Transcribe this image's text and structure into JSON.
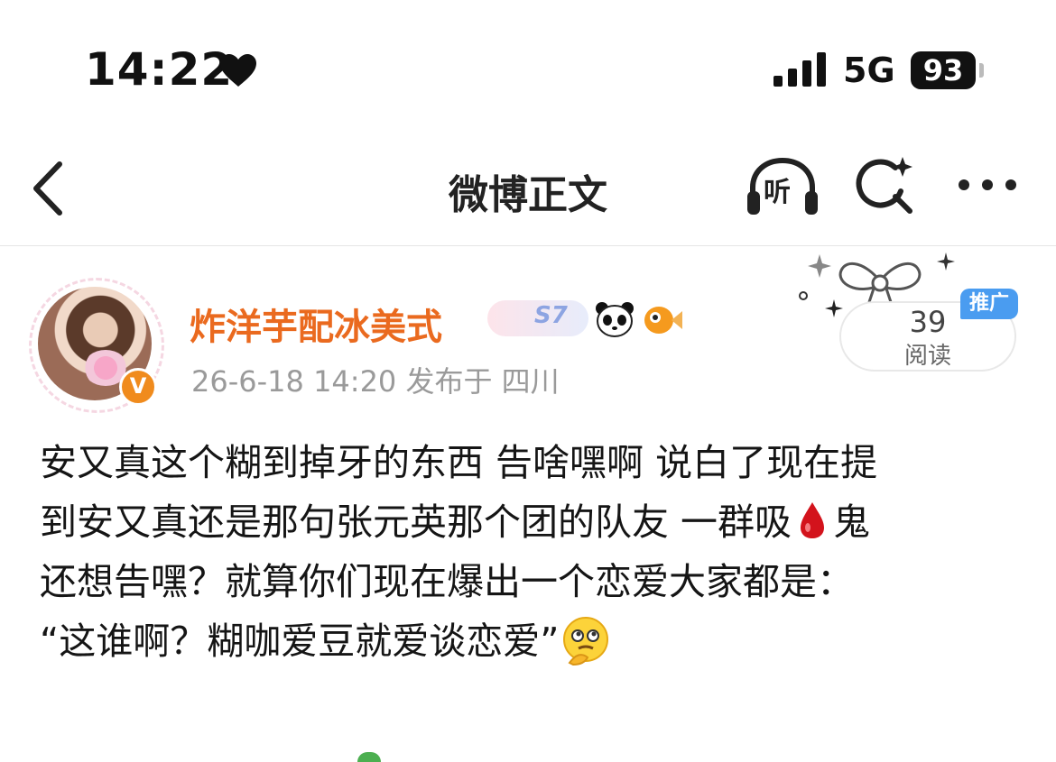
{
  "status_bar": {
    "time": "14:22",
    "network": "5G",
    "battery": "93"
  },
  "nav": {
    "title": "微博正文",
    "listen_label": "听"
  },
  "post": {
    "username": "炸洋芋配冰美式",
    "badge_text": "S7",
    "verified_mark": "V",
    "meta": "26-6-18 14:20  发布于 四川",
    "read_count": "39",
    "read_label": "阅读",
    "promo_tag": "推广",
    "lines": [
      "安又真这个糊到掉牙的东西 告啥嘿啊 说白了现在提",
      "到安又真还是那句张元英那个团的队友 一群吸",
      "鬼",
      "还想告嘿？就算你们现在爆出一个恋爱大家都是：",
      "“这谁啊？糊咖爱豆就爱谈恋爱”"
    ]
  },
  "colors": {
    "username": "#ea6a1f",
    "verified": "#f08b1d",
    "promo": "#4a9cf0",
    "meta": "#9a9a9a"
  },
  "icons": [
    "heart-icon",
    "signal-icon",
    "back-icon",
    "listen-icon",
    "search-sparkle-icon",
    "more-icon",
    "panda-icon",
    "fish-icon",
    "blood-drop-icon",
    "thinking-face-icon"
  ]
}
